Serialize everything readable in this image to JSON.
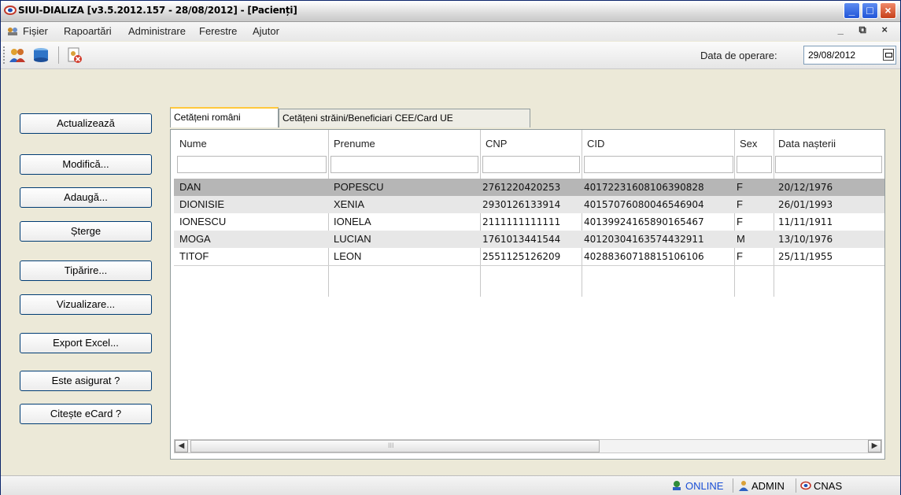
{
  "window": {
    "title": "SIUI-DIALIZA [v3.5.2012.157 - 28/08/2012] - [Pacienți]",
    "minimize_icon": "minimize-icon",
    "maximize_icon": "maximize-icon",
    "close_icon": "close-icon"
  },
  "menu": {
    "items": [
      "Fișier",
      "Rapoartări",
      "Administrare",
      "Ferestre",
      "Ajutor"
    ],
    "mdi_controls": "_ ⧉ ×"
  },
  "toolbar": {
    "icons": [
      "patients-icon",
      "database-icon",
      "document-close-icon"
    ],
    "date_label": "Data de operare:",
    "date_value": "29/08/2012"
  },
  "sidebar": {
    "buttons": [
      "Actualizează",
      "Modifică...",
      "Adaugă...",
      "Șterge",
      "Tipărire...",
      "Vizualizare...",
      "Export Excel...",
      "Este asigurat ?",
      "Citește eCard ?"
    ]
  },
  "tabs": [
    "Cetățeni români",
    "Cetățeni străini/Beneficiari CEE/Card UE"
  ],
  "table": {
    "columns": [
      "Nume",
      "Prenume",
      "CNP",
      "CID",
      "Sex",
      "Data nașterii"
    ],
    "rows": [
      [
        "DAN",
        "POPESCU",
        "2761220420253",
        "40172231608106390828",
        "F",
        "20/12/1976"
      ],
      [
        "DIONISIE",
        "XENIA",
        "2930126133914",
        "40157076080046546904",
        "F",
        "26/01/1993"
      ],
      [
        "IONESCU",
        "IONELA",
        "2111111111111",
        "40139924165890165467",
        "F",
        "11/11/1911"
      ],
      [
        "MOGA",
        "LUCIAN",
        "1761013441544",
        "40120304163574432911",
        "M",
        "13/10/1976"
      ],
      [
        "TITOF",
        "LEON",
        "2551125126209",
        "40288360718815106106",
        "F",
        "25/11/1955"
      ]
    ]
  },
  "status": {
    "online": "ONLINE",
    "user": "ADMIN",
    "server": "CNAS",
    "online_color": "#1a4fd6"
  }
}
